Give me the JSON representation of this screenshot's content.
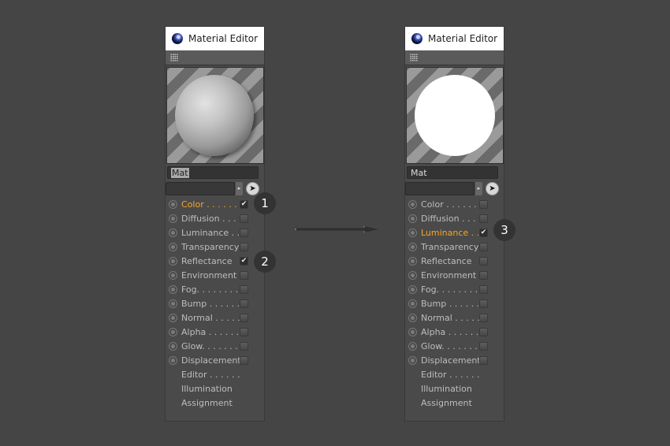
{
  "panels": [
    {
      "title": "Material Editor",
      "material_name": "Mat",
      "name_selected": true,
      "preview": "sphere-shaded",
      "picker_icon": "cursor-arrow-icon",
      "dropdown_arrow": "▸",
      "channels": [
        {
          "label": "Color . . . . . .",
          "checked": true,
          "active": true
        },
        {
          "label": "Diffusion . . .",
          "checked": false,
          "active": false
        },
        {
          "label": "Luminance . .",
          "checked": false,
          "active": false
        },
        {
          "label": "Transparency",
          "checked": false,
          "active": false
        },
        {
          "label": "Reflectance",
          "checked": true,
          "active": false
        },
        {
          "label": "Environment",
          "checked": false,
          "active": false
        },
        {
          "label": "Fog. . . . . . . .",
          "checked": false,
          "active": false
        },
        {
          "label": "Bump . . . . . .",
          "checked": false,
          "active": false
        },
        {
          "label": "Normal . . . . .",
          "checked": false,
          "active": false
        },
        {
          "label": "Alpha . . . . . .",
          "checked": false,
          "active": false
        },
        {
          "label": "Glow. . . . . . .",
          "checked": false,
          "active": false
        },
        {
          "label": "Displacement",
          "checked": false,
          "active": false
        }
      ],
      "extras": [
        "Editor . . . . . .",
        "Illumination",
        "Assignment"
      ]
    },
    {
      "title": "Material Editor",
      "material_name": "Mat",
      "name_selected": false,
      "preview": "sphere-luminous",
      "picker_icon": "cursor-arrow-icon",
      "dropdown_arrow": "▸",
      "channels": [
        {
          "label": "Color . . . . . .",
          "checked": false,
          "active": false
        },
        {
          "label": "Diffusion . . .",
          "checked": false,
          "active": false
        },
        {
          "label": "Luminance . .",
          "checked": true,
          "active": true
        },
        {
          "label": "Transparency",
          "checked": false,
          "active": false
        },
        {
          "label": "Reflectance",
          "checked": false,
          "active": false
        },
        {
          "label": "Environment",
          "checked": false,
          "active": false
        },
        {
          "label": "Fog. . . . . . . .",
          "checked": false,
          "active": false
        },
        {
          "label": "Bump . . . . . .",
          "checked": false,
          "active": false
        },
        {
          "label": "Normal . . . . .",
          "checked": false,
          "active": false
        },
        {
          "label": "Alpha . . . . . .",
          "checked": false,
          "active": false
        },
        {
          "label": "Glow. . . . . . .",
          "checked": false,
          "active": false
        },
        {
          "label": "Displacement",
          "checked": false,
          "active": false
        }
      ],
      "extras": [
        "Editor . . . . . .",
        "Illumination",
        "Assignment"
      ]
    }
  ],
  "badges": [
    "1",
    "2",
    "3"
  ],
  "check_glyph": "✔",
  "colors": {
    "active_label": "#f5a623",
    "background": "#454545"
  }
}
